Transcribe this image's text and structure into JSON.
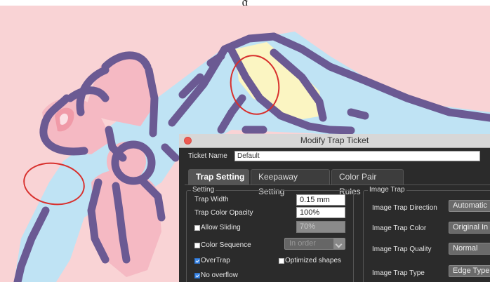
{
  "dialog": {
    "title": "Modify Trap Ticket",
    "ticket_name_label": "Ticket Name",
    "ticket_name_value": "Default",
    "tabs": [
      {
        "label": "Trap Setting",
        "active": true
      },
      {
        "label": "Keepaway Setting",
        "active": false
      },
      {
        "label": "Color Pair Rules",
        "active": false
      }
    ],
    "setting": {
      "group_title": "Setting",
      "trap_width_label": "Trap Width",
      "trap_width_value": "0.15 mm",
      "trap_color_opacity_label": "Trap Color Opacity",
      "trap_color_opacity_value": "100%",
      "allow_sliding_label": "Allow Sliding",
      "allow_sliding_checked": false,
      "allow_sliding_value": "70%",
      "color_sequence_label": "Color Sequence",
      "color_sequence_checked": false,
      "color_sequence_value": "In order",
      "overtrap_label": "OverTrap",
      "overtrap_checked": true,
      "optimized_shapes_label": "Optimized shapes",
      "optimized_shapes_checked": false,
      "no_overflow_label": "No overflow",
      "no_overflow_checked": true
    },
    "image_trap": {
      "group_title": "Image Trap",
      "direction_label": "Image Trap Direction",
      "direction_value": "Automatic",
      "color_label": "Image Trap Color",
      "color_value": "Original In",
      "quality_label": "Image Trap Quality",
      "quality_value": "Normal",
      "type_label": "Image Trap Type",
      "type_value": "Edge Type"
    }
  },
  "colors": {
    "background_pink": "#f9d3d5",
    "outline_purple": "#6b5a93",
    "fill_blue": "#bfe3f4",
    "fill_pink": "#f5b9c3",
    "fill_yellow": "#fbf5c2",
    "highlight_red": "#d8302d",
    "close_button": "#ee5a52"
  }
}
